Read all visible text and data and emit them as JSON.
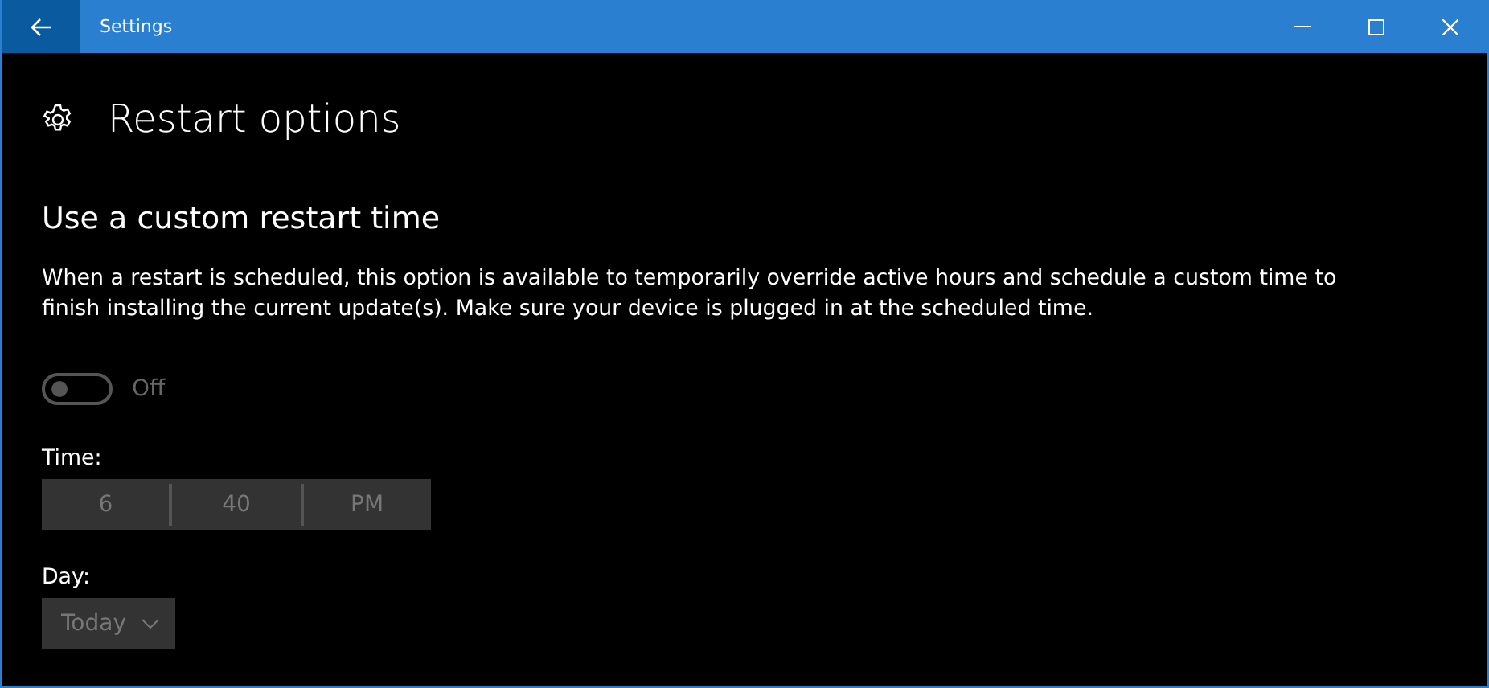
{
  "window": {
    "title": "Settings"
  },
  "page": {
    "title": "Restart options"
  },
  "section": {
    "heading": "Use a custom restart time",
    "description": "When a restart is scheduled, this option is available to temporarily override active hours and schedule a custom time to finish installing the current update(s). Make sure your device is plugged in at the scheduled time."
  },
  "toggle": {
    "on": false,
    "disabled": true,
    "label": "Off"
  },
  "time_picker": {
    "label": "Time:",
    "disabled": true,
    "parts": [
      "6",
      "40",
      "PM"
    ]
  },
  "day_picker": {
    "label": "Day:",
    "disabled": true,
    "value": "Today"
  }
}
